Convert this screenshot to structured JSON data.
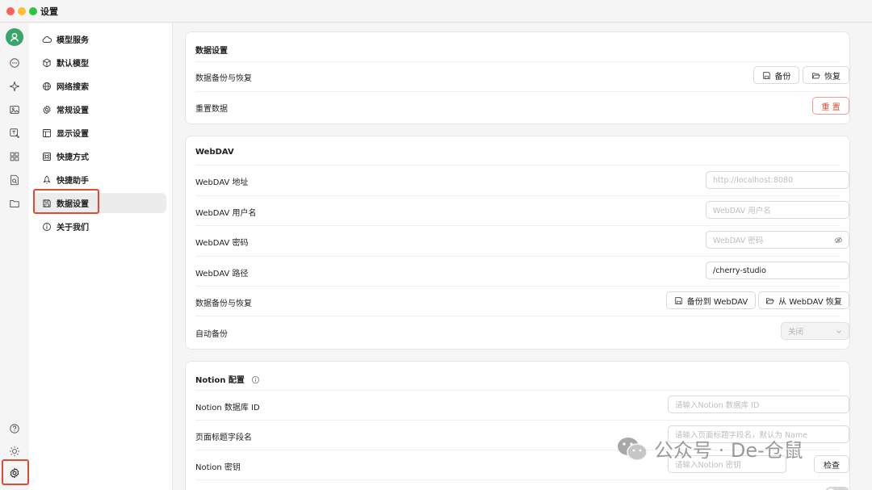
{
  "window": {
    "title": "设置"
  },
  "rail": {
    "icons": [
      "avatar-icon",
      "chat-icon",
      "sparkle-icon",
      "image-icon",
      "translate-icon",
      "apps-icon",
      "document-search-icon",
      "folder-icon"
    ],
    "bottom_icons": [
      "help-icon",
      "sun-icon",
      "settings-icon"
    ],
    "avatar_color": "#3aa56a",
    "highlight_color": "#e04a33"
  },
  "nav": {
    "items": [
      {
        "label": "模型服务",
        "icon": "cloud-icon"
      },
      {
        "label": "默认模型",
        "icon": "cube-icon"
      },
      {
        "label": "网络搜索",
        "icon": "globe-icon"
      },
      {
        "label": "常规设置",
        "icon": "gear-icon"
      },
      {
        "label": "显示设置",
        "icon": "layout-icon"
      },
      {
        "label": "快捷方式",
        "icon": "command-icon"
      },
      {
        "label": "快捷助手",
        "icon": "rocket-icon"
      },
      {
        "label": "数据设置",
        "icon": "save-icon",
        "active": true
      },
      {
        "label": "关于我们",
        "icon": "info-icon"
      }
    ]
  },
  "data_card": {
    "title": "数据设置",
    "backup_label": "数据备份与恢复",
    "backup_button": "备份",
    "restore_button": "恢复",
    "reset_label": "重置数据",
    "reset_button": "重 置"
  },
  "webdav_card": {
    "title": "WebDAV",
    "address_label": "WebDAV 地址",
    "address_placeholder": "http://localhost:8080",
    "username_label": "WebDAV 用户名",
    "username_placeholder": "WebDAV 用户名",
    "password_label": "WebDAV 密码",
    "password_placeholder": "WebDAV 密码",
    "path_label": "WebDAV 路径",
    "path_value": "/cherry-studio",
    "backup_label": "数据备份与恢复",
    "backup_button": "备份到 WebDAV",
    "restore_button": "从 WebDAV 恢复",
    "auto_label": "自动备份",
    "auto_value": "关闭"
  },
  "notion_card": {
    "title": "Notion 配置",
    "db_label": "Notion 数据库 ID",
    "db_placeholder": "请输入Notion 数据库 ID",
    "page_label": "页面标题字段名",
    "page_placeholder": "请输入页面标题字段名，默认为 Name",
    "key_label": "Notion 密钥",
    "key_placeholder": "请输入Notion 密钥",
    "check_button": "检查"
  },
  "watermark": {
    "text": "公众号 · De-仓鼠"
  },
  "colors": {
    "accent_danger": "#e04a33",
    "active_nav_bg": "#ececec"
  }
}
